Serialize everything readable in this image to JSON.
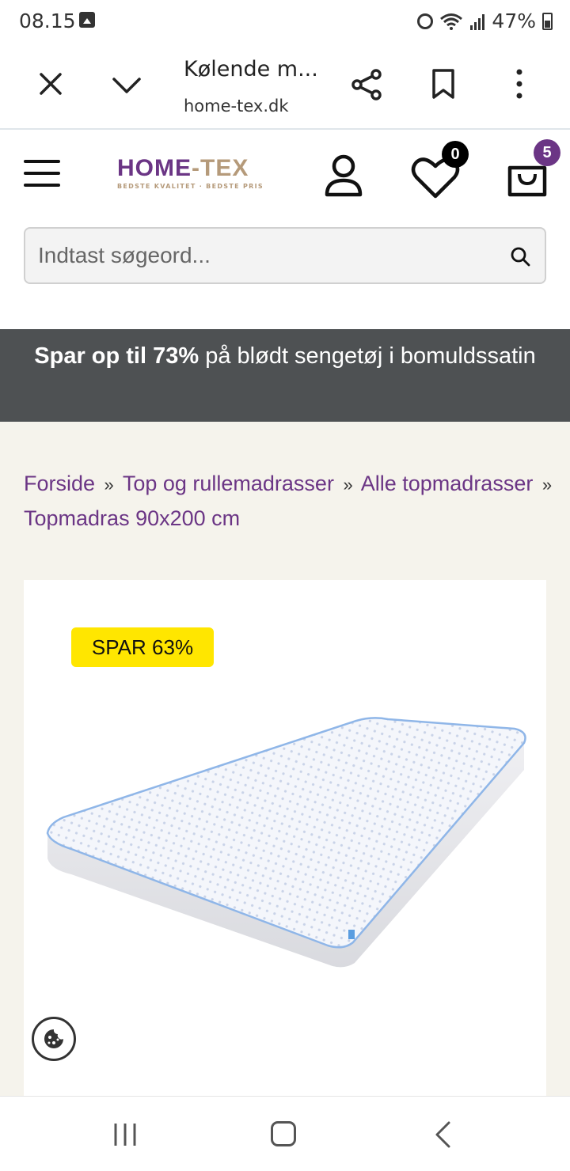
{
  "status_bar": {
    "time": "08.15",
    "battery": "47%"
  },
  "custom_tab": {
    "title": "Kølende m...",
    "url": "home-tex.dk"
  },
  "header": {
    "logo_main_1": "HOME",
    "logo_main_2": "-TEX",
    "logo_tagline": "BEDSTE KVALITET · BEDSTE PRIS",
    "wishlist_count": "0",
    "cart_count": "5"
  },
  "search": {
    "placeholder": "Indtast søgeord..."
  },
  "promo": {
    "bold": "Spar op til 73%",
    "rest": " på blødt sengetøj i bomuldssatin"
  },
  "breadcrumb": {
    "items": [
      "Forside",
      "Top og rullemadrasser",
      "Alle topmadrasser",
      "Topmadras 90x200 cm"
    ],
    "separator": "»"
  },
  "product": {
    "save_badge": "SPAR 63%"
  },
  "colors": {
    "brand_purple": "#6b3585",
    "brand_gold": "#b59a7a",
    "promo_bg": "#4e5153",
    "badge_yellow": "#ffe600",
    "page_beige": "#f5f3ec"
  },
  "icons": {
    "status_gallery": "gallery-icon",
    "status_alarm": "alarm-icon",
    "status_wifi": "wifi-icon",
    "status_signal": "signal-icon",
    "status_battery": "battery-icon",
    "close": "close-icon",
    "collapse": "chevron-down-icon",
    "share": "share-icon",
    "bookmark": "bookmark-icon",
    "more": "more-vert-icon",
    "menu": "hamburger-menu-icon",
    "account": "user-icon",
    "wishlist": "heart-icon",
    "cart": "shopping-bag-icon",
    "search": "search-icon",
    "cookie": "cookie-icon",
    "nav_recent": "recent-apps-icon",
    "nav_home": "home-icon",
    "nav_back": "back-icon"
  }
}
